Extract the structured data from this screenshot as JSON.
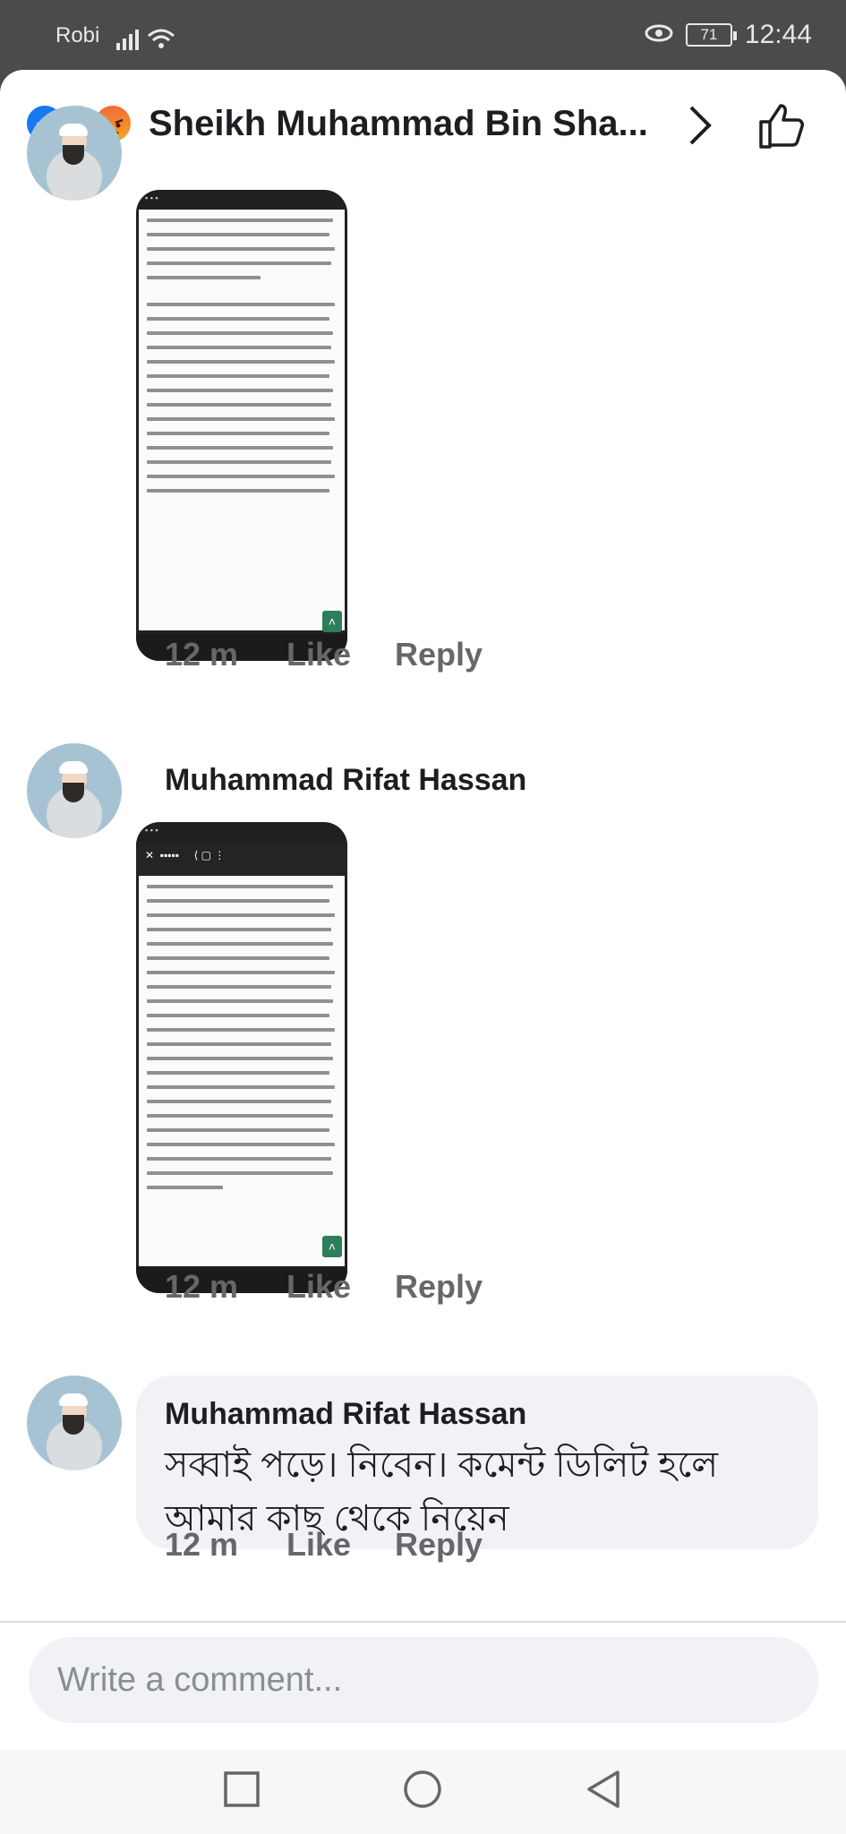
{
  "status_bar": {
    "carrier": "Robi",
    "battery": "71",
    "time": "12:44"
  },
  "header": {
    "title": "Sheikh Muhammad Bin Sha...",
    "reaction_icons": [
      "like-reaction",
      "haha-reaction",
      "angry-reaction"
    ]
  },
  "comments": [
    {
      "time": "12 m",
      "like_label": "Like",
      "reply_label": "Reply"
    },
    {
      "author": "Muhammad Rifat Hassan",
      "time": "12 m",
      "like_label": "Like",
      "reply_label": "Reply"
    },
    {
      "author": "Muhammad Rifat Hassan",
      "text": "সব্বাই পড়ে। নিবেন। কমেন্ট ডিলিট হলে আমার কাছ থেকে নিয়েন",
      "time": "12 m",
      "like_label": "Like",
      "reply_label": "Reply"
    }
  ],
  "composer": {
    "placeholder": "Write a comment..."
  },
  "colors": {
    "like_blue": "#1877f2",
    "text_primary": "#1c1e21",
    "text_secondary": "#65676b",
    "bubble_bg": "#f0f2f5"
  }
}
